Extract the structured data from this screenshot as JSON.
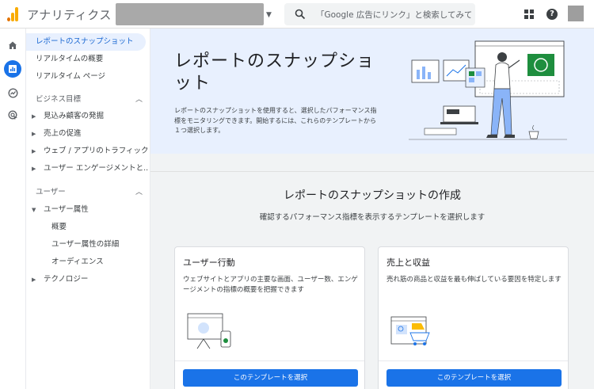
{
  "app": {
    "title": "アナリティクス",
    "search_placeholder": "「Google 広告にリンク」と検索してみてく..."
  },
  "colors": {
    "accent": "#1a73e8",
    "hero_bg": "#e8f0fe",
    "logo_orange": "#f9ab00",
    "logo_dark": "#e37400",
    "illustration_green": "#1e8e3e"
  },
  "sidebar": {
    "top_items": [
      {
        "label": "レポートのスナップショット"
      },
      {
        "label": "リアルタイムの概要"
      },
      {
        "label": "リアルタイム ページ"
      }
    ],
    "sections": [
      {
        "title": "ビジネス目標",
        "items": [
          {
            "label": "見込み顧客の発掘"
          },
          {
            "label": "売上の促進"
          },
          {
            "label": "ウェブ / アプリのトラフィック..."
          },
          {
            "label": "ユーザー エンゲージメントと..."
          }
        ]
      },
      {
        "title": "ユーザー",
        "items": [
          {
            "label": "ユーザー属性"
          },
          {
            "label": "テクノロジー"
          }
        ],
        "children": [
          {
            "label": "概要"
          },
          {
            "label": "ユーザー属性の詳細"
          },
          {
            "label": "オーディエンス"
          }
        ]
      }
    ]
  },
  "hero": {
    "title": "レポートのスナップショット",
    "description": "レポートのスナップショットを使用すると、選択したパフォーマンス指標をモニタリングできます。開始するには、これらのテンプレートから１つ選択します。"
  },
  "panel": {
    "title": "レポートのスナップショットの作成",
    "subtitle": "確認するパフォーマンス指標を表示するテンプレートを選択します"
  },
  "cards": [
    {
      "title": "ユーザー行動",
      "description": "ウェブサイトとアプリの主要な画面、ユーザー数、エンゲージメントの指標の概要を把握できます",
      "button": "このテンプレートを選択"
    },
    {
      "title": "売上と収益",
      "description": "売れ筋の商品と収益を最も伸ばしている要因を特定します",
      "button": "このテンプレートを選択"
    }
  ]
}
